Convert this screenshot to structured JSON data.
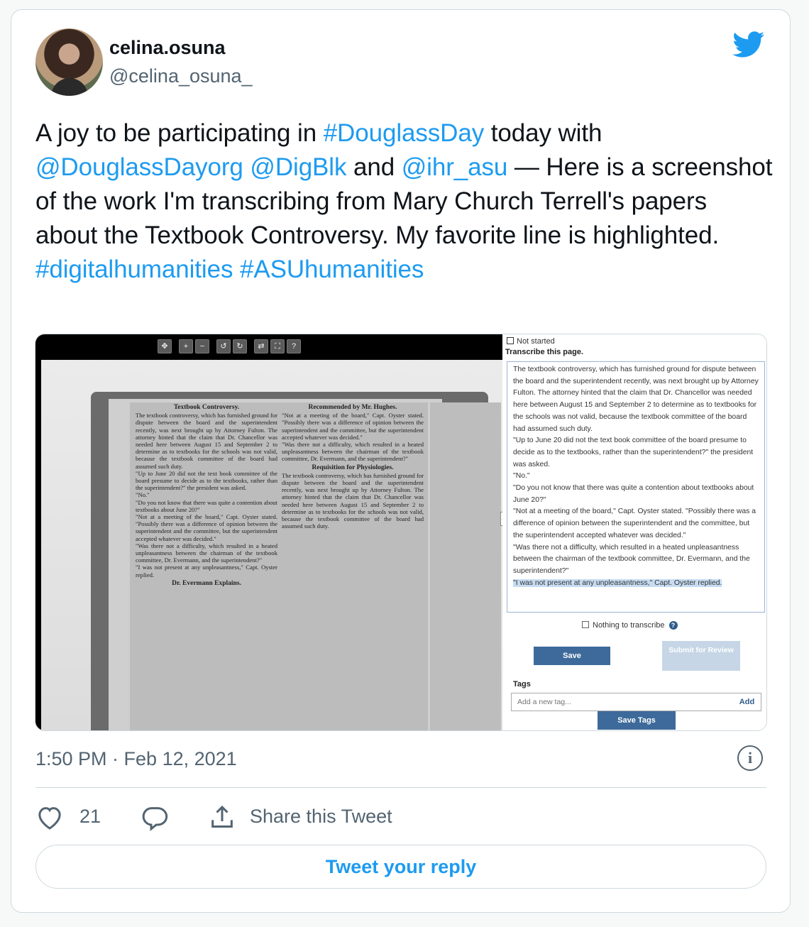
{
  "user": {
    "name": "celina.osuna",
    "handle": "@celina_osuna_"
  },
  "tweet": {
    "segments": [
      {
        "text": "A joy to be participating in ",
        "link": false
      },
      {
        "text": "#DouglassDay",
        "link": true
      },
      {
        "text": " today with ",
        "link": false
      },
      {
        "text": "@DouglassDayorg",
        "link": true
      },
      {
        "text": " ",
        "link": false
      },
      {
        "text": "@DigBlk",
        "link": true
      },
      {
        "text": " and ",
        "link": false
      },
      {
        "text": "@ihr_asu",
        "link": true
      },
      {
        "text": " — Here is a screenshot of the work I'm transcribing from Mary Church Terrell's papers about the Textbook Controversy. My favorite line is highlighted. ",
        "link": false
      },
      {
        "text": "#digitalhumanities",
        "link": true
      },
      {
        "text": " ",
        "link": false
      },
      {
        "text": "#ASUhumanities",
        "link": true
      }
    ]
  },
  "media": {
    "status": "Not started",
    "instruction": "Transcribe this page.",
    "transcript": [
      "The textbook controversy, which has furnished ground for dispute between the board and the superintendent recently, was next brought up by Attorney Fulton. The attorney hinted that the claim that Dr. Chancellor was needed here between August 15 and September 2 to determine as to textbooks for the schools was not valid, because the textbook committee of the board had assumed such duty.",
      "\"Up to June 20 did not the text book committee of the board presume to decide as to the textbooks, rather than the superintendent?\" the president was asked.",
      "\"No.\"",
      "\"Do you not know that there was quite a contention about textbooks about June 20?\"",
      "\"Not at a meeting of the board,\" Capt. Oyster stated. \"Possibly there was a difference of opinion between the superintendent and the committee, but the superintendent accepted whatever was decided.\"",
      "\"Was there not a difficulty, which resulted in a heated unpleasantness between the chairman of the textbook committee, Dr. Evermann, and the superintendent?\""
    ],
    "transcript_highlight": "\"I was not present at any unpleasantness,\" Capt. Oyster replied.",
    "nothing_label": "Nothing to transcribe",
    "save_label": "Save",
    "review_label": "Submit for Review",
    "tags_label": "Tags",
    "tag_placeholder": "Add a new tag...",
    "add_label": "Add",
    "save_tags_label": "Save Tags",
    "toolbar_icons": [
      "move-icon",
      "zoom-in-icon",
      "zoom-out-icon",
      "rotate-left-icon",
      "rotate-right-icon",
      "flip-icon",
      "fullscreen-icon",
      "help-icon"
    ],
    "scan": {
      "col1_heading": "Textbook Controversy.",
      "col1_heading2": "Dr. Evermann Explains.",
      "col2_heading": "Recommended by Mr. Hughes.",
      "col2_heading2": "Requisition for Physiologies."
    }
  },
  "meta": {
    "timestamp": "1:50 PM · Feb 12, 2021",
    "likes": "21",
    "share_label": "Share this Tweet",
    "reply_label": "Tweet your reply"
  },
  "colors": {
    "link": "#1d9bf0",
    "muted": "#536471",
    "button_blue": "#3d6a9a"
  }
}
